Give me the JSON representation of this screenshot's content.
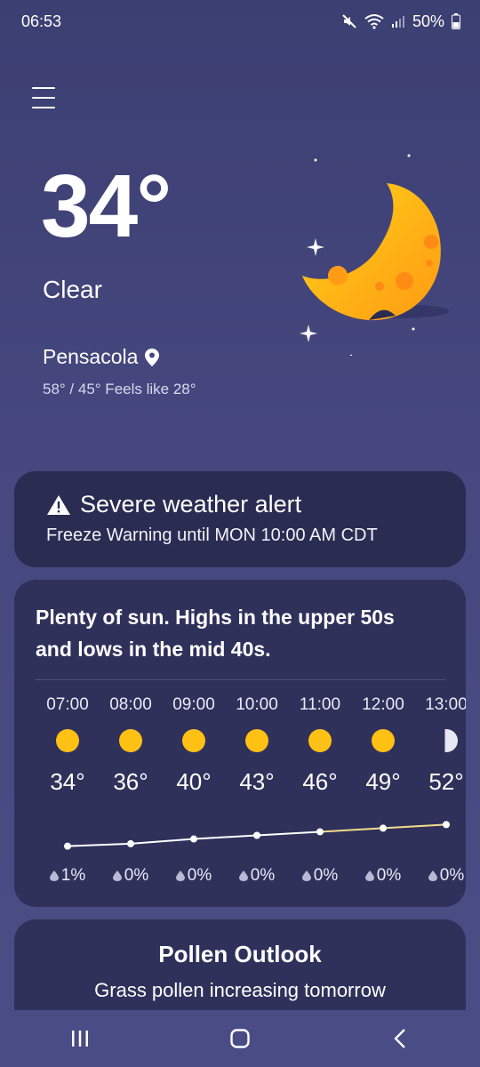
{
  "status_bar": {
    "time": "06:53",
    "battery": "50%"
  },
  "current": {
    "temperature": "34°",
    "condition": "Clear",
    "location": "Pensacola",
    "hi_lo_feels": "58° / 45° Feels like 28°"
  },
  "alert": {
    "title": "Severe weather alert",
    "detail": "Freeze Warning until MON 10:00 AM CDT"
  },
  "forecast": {
    "summary": "Plenty of sun. Highs in the upper 50s and lows in the mid 40s.",
    "hours": [
      {
        "time": "07:00",
        "icon": "sun-icon",
        "temp": "34°",
        "temp_value": 34,
        "precip": "1%"
      },
      {
        "time": "08:00",
        "icon": "sun-icon",
        "temp": "36°",
        "temp_value": 36,
        "precip": "0%"
      },
      {
        "time": "09:00",
        "icon": "sun-icon",
        "temp": "40°",
        "temp_value": 40,
        "precip": "0%"
      },
      {
        "time": "10:00",
        "icon": "sun-icon",
        "temp": "43°",
        "temp_value": 43,
        "precip": "0%"
      },
      {
        "time": "11:00",
        "icon": "sun-icon",
        "temp": "46°",
        "temp_value": 46,
        "precip": "0%"
      },
      {
        "time": "12:00",
        "icon": "sun-icon",
        "temp": "49°",
        "temp_value": 49,
        "precip": "0%"
      },
      {
        "time": "13:00",
        "icon": "partly-cloudy-icon",
        "temp": "52°",
        "temp_value": 52,
        "precip": "0%"
      }
    ]
  },
  "pollen": {
    "title": "Pollen Outlook",
    "detail": "Grass pollen increasing tomorrow"
  },
  "colors": {
    "sun": "#ffc114",
    "background": "#45477e",
    "card": "#2f315b"
  }
}
